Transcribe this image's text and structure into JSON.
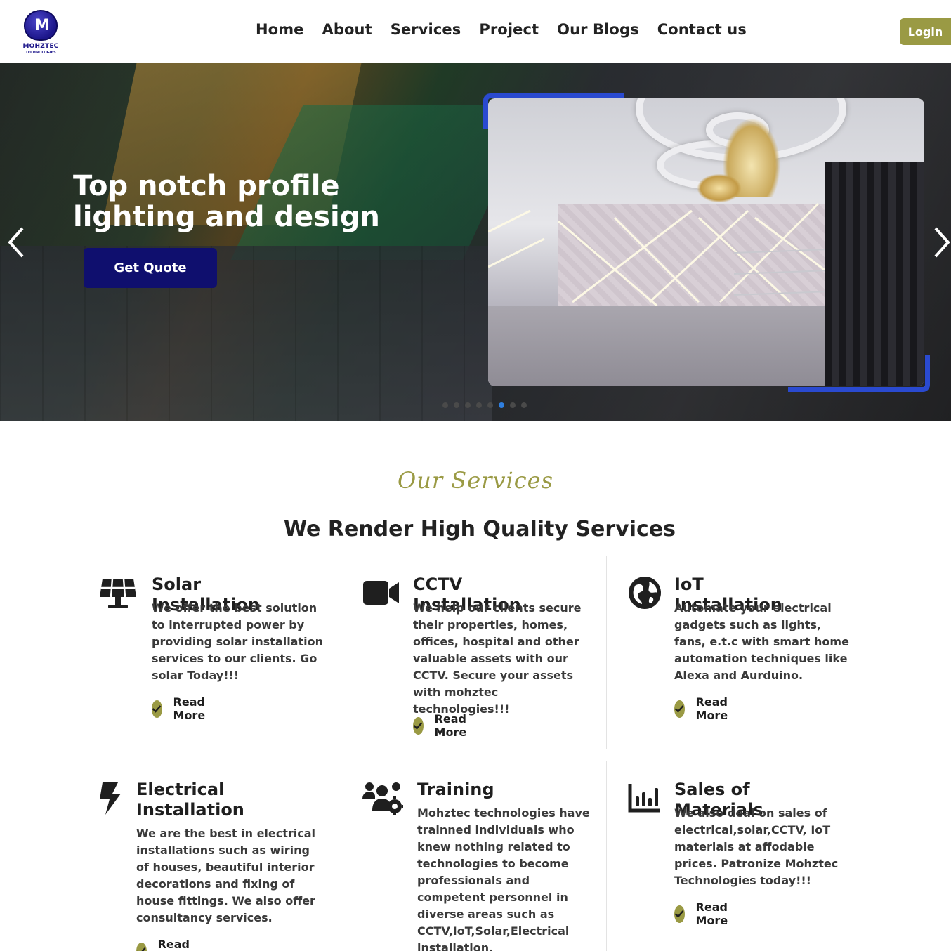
{
  "brand": {
    "logo_letter": "M",
    "name": "MOHZTEC",
    "sub": "TECHNOLOGIES"
  },
  "nav": {
    "items": [
      "Home",
      "About",
      "Services",
      "Project",
      "Our Blogs",
      "Contact us"
    ],
    "login_label": "Login"
  },
  "hero": {
    "title": "Top notch profile lighting and design",
    "cta_label": "Get Quote",
    "slide_count": 8,
    "active_slide_index": 5
  },
  "services_section": {
    "script_title": "Our Services",
    "title": "We Render High Quality Services",
    "read_more_label": "Read More",
    "items": [
      {
        "icon": "solar-panel-icon",
        "title": "Solar Installation",
        "description": "We offer the best solution to interrupted power by providing solar installation services to our clients. Go solar Today!!!"
      },
      {
        "icon": "video-camera-icon",
        "title": "CCTV Installation",
        "description": "We help our clients secure their properties, homes, offices, hospital and other valuable assets with our CCTV. Secure your assets with mohztec technologies!!!"
      },
      {
        "icon": "globe-icon",
        "title": "IoT Installation",
        "description": "Automate your electrical gadgets such as lights, fans, e.t.c with smart home automation techniques like Alexa and Aurduino."
      },
      {
        "icon": "lightning-bolt-icon",
        "title": "Electrical Installation",
        "description": "We are the best in electrical installations such as wiring of houses, beautiful interior decorations and fixing of house fittings. We also offer consultancy services."
      },
      {
        "icon": "users-gear-icon",
        "title": "Training",
        "description": "Mohztec technologies have trainned individuals who knew nothing related to technologies to become professionals and competent personnel in diverse areas such as CCTV,IoT,Solar,Electrical installation."
      },
      {
        "icon": "bar-chart-icon",
        "title": "Sales of Materials",
        "description": "We also deal on sales of electrical,solar,CCTV, IoT materials at affodable prices. Patronize Mohztec Technologies today!!!"
      }
    ]
  },
  "colors": {
    "accent_olive": "#9a9a44",
    "cta_navy": "#0f0f6e",
    "frame_blue": "#2a4ad0"
  }
}
